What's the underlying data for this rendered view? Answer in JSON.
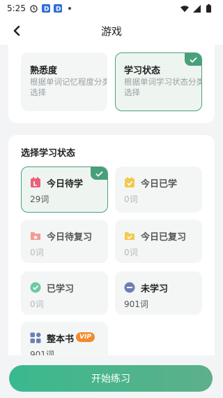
{
  "status_bar": {
    "time": "5:25"
  },
  "nav": {
    "title": "游戏"
  },
  "mode_options": [
    {
      "title": "熟悉度",
      "desc": "根据单词记忆程度分类选择"
    },
    {
      "title": "学习状态",
      "desc": "根据单词学习状态分类选择"
    }
  ],
  "section": {
    "title": "选择学习状态"
  },
  "states": [
    {
      "name": "今日待学",
      "count": "29词",
      "icon": "calendar-l-icon",
      "color": "#e8607a"
    },
    {
      "name": "今日已学",
      "count": "0词",
      "icon": "calendar-check-icon",
      "color": "#f2c94c"
    },
    {
      "name": "今日待复习",
      "count": "0词",
      "icon": "folder-star-icon",
      "color": "#f29b94"
    },
    {
      "name": "今日已复习",
      "count": "0词",
      "icon": "folder-check-icon",
      "color": "#f5c94e"
    },
    {
      "name": "已学习",
      "count": "0词",
      "icon": "check-circle-icon",
      "color": "#6cc9a1"
    },
    {
      "name": "未学习",
      "count": "901词",
      "icon": "minus-circle-icon",
      "color": "#6b7fb4"
    },
    {
      "name": "整本书",
      "count": "901词",
      "icon": "grid-icon",
      "color": "#6b7fb4",
      "badge": "VIP"
    }
  ],
  "footer": {
    "start_label": "开始练习"
  },
  "colors": {
    "accent": "#48a07a",
    "vip": "#f28b2c"
  }
}
